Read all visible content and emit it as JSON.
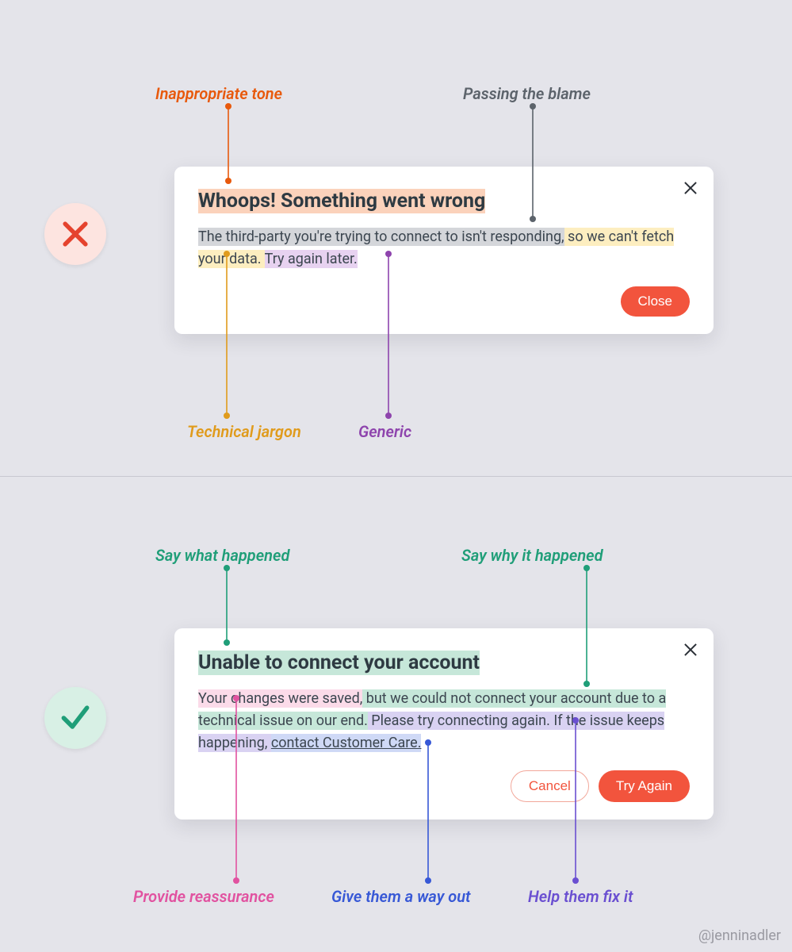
{
  "credit": "@jenninadler",
  "bad": {
    "title": "Whoops! Something went wrong",
    "body_part1": "The third-party you're trying to connect to isn't responding,",
    "body_part2": " so we can't fetch your data. ",
    "body_part3": "Try again later.",
    "close_label": "Close",
    "annotations": {
      "tone": "Inappropriate tone",
      "blame": "Passing the blame",
      "jargon": "Technical jargon",
      "generic": "Generic"
    }
  },
  "good": {
    "title": "Unable to connect your account",
    "body_reassure": "Your changes were saved,",
    "body_why": " but we could not connect your account due to a technical issue on our end.",
    "body_fixit": " Please try connecting again. If the issue keeps happening, ",
    "body_wayout": "contact Customer Care.",
    "cancel_label": "Cancel",
    "try_label": "Try Again",
    "annotations": {
      "what": "Say what happened",
      "why": "Say why it happened",
      "reassure": "Provide reassurance",
      "wayout": "Give them a way out",
      "fixit": "Help them fix it"
    }
  }
}
